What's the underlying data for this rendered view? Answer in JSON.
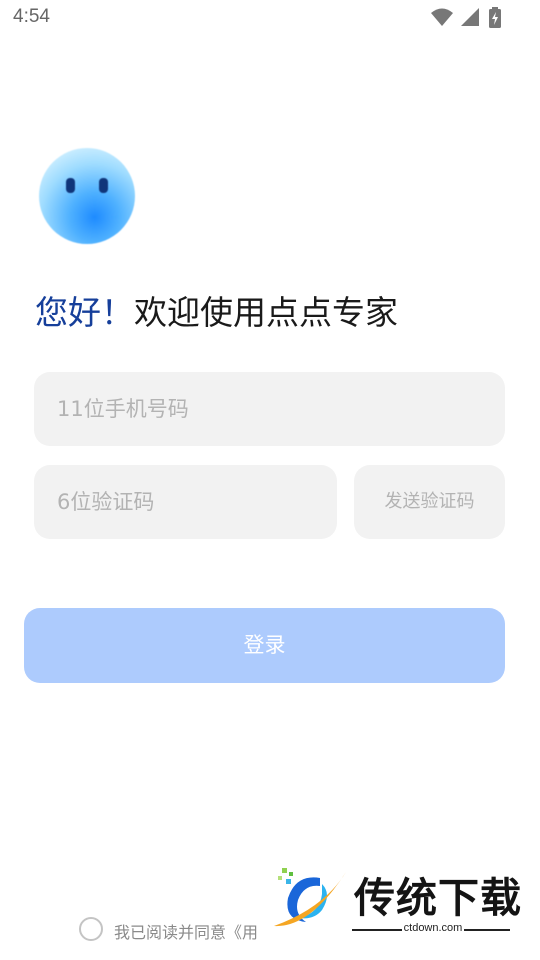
{
  "status_bar": {
    "time": "4:54",
    "icons": [
      "wifi-icon",
      "signal-icon",
      "battery-charging-icon"
    ]
  },
  "mascot": {
    "icon": "blob-mascot-icon",
    "color": "#2f96ff"
  },
  "greeting": {
    "accent_text": "您好！",
    "main_text": "欢迎使用点点专家",
    "accent_color": "#163f9a"
  },
  "form": {
    "phone_placeholder": "11位手机号码",
    "code_placeholder": "6位验证码",
    "send_code_label": "发送验证码",
    "login_label": "登录",
    "login_color": "#adcbfd"
  },
  "agreement": {
    "text": "我已阅读并同意《用"
  },
  "watermark": {
    "title": "传统下载",
    "url": "ctdown.com"
  }
}
